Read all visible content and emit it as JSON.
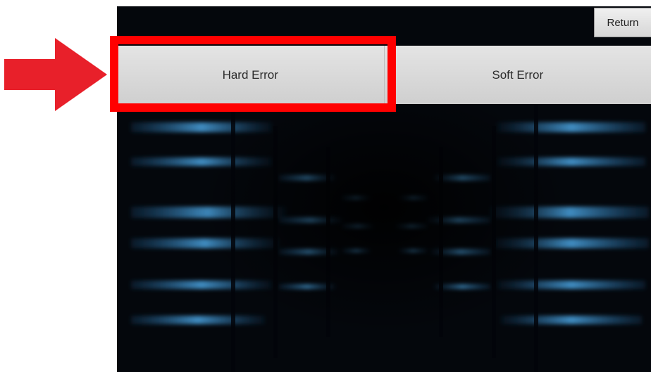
{
  "screen": {
    "return_label": "Return",
    "tabs": [
      {
        "label": "Hard Error"
      },
      {
        "label": "Soft Error"
      }
    ]
  },
  "annotation": {
    "color": "#ff0000",
    "arrow_color": "#e8202a",
    "highlighted_tab": "Hard Error"
  }
}
